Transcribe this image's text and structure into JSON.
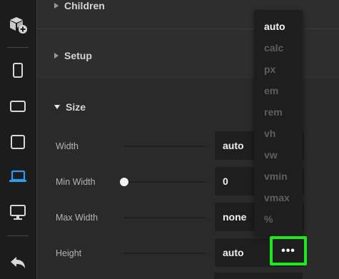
{
  "toolbar": {
    "items": [
      {
        "icon": "add-component-icon",
        "active": false
      },
      {
        "icon": "mobile-icon",
        "active": false
      },
      {
        "icon": "tablet-landscape-icon",
        "active": false
      },
      {
        "icon": "tablet-portrait-icon",
        "active": false
      },
      {
        "icon": "laptop-icon",
        "active": true
      },
      {
        "icon": "desktop-icon",
        "active": false
      },
      {
        "icon": "undo-icon",
        "active": false
      }
    ],
    "active_color": "#2b9cf2"
  },
  "sections": {
    "children": {
      "title": "Children"
    },
    "setup": {
      "title": "Setup"
    },
    "size": {
      "title": "Size"
    }
  },
  "size": {
    "rows": [
      {
        "label": "Width",
        "value": "auto"
      },
      {
        "label": "Min Width",
        "value": "0",
        "slider_level": 0
      },
      {
        "label": "Max Width",
        "value": "none"
      },
      {
        "label": "Height",
        "value": "auto"
      }
    ]
  },
  "unit_dropdown": {
    "options": [
      "auto",
      "calc",
      "px",
      "em",
      "rem",
      "vh",
      "vw",
      "vmin",
      "vmax",
      "%"
    ],
    "selected": "auto"
  },
  "more_button": {
    "label": "•••",
    "highlight_color": "#1ee81e"
  }
}
